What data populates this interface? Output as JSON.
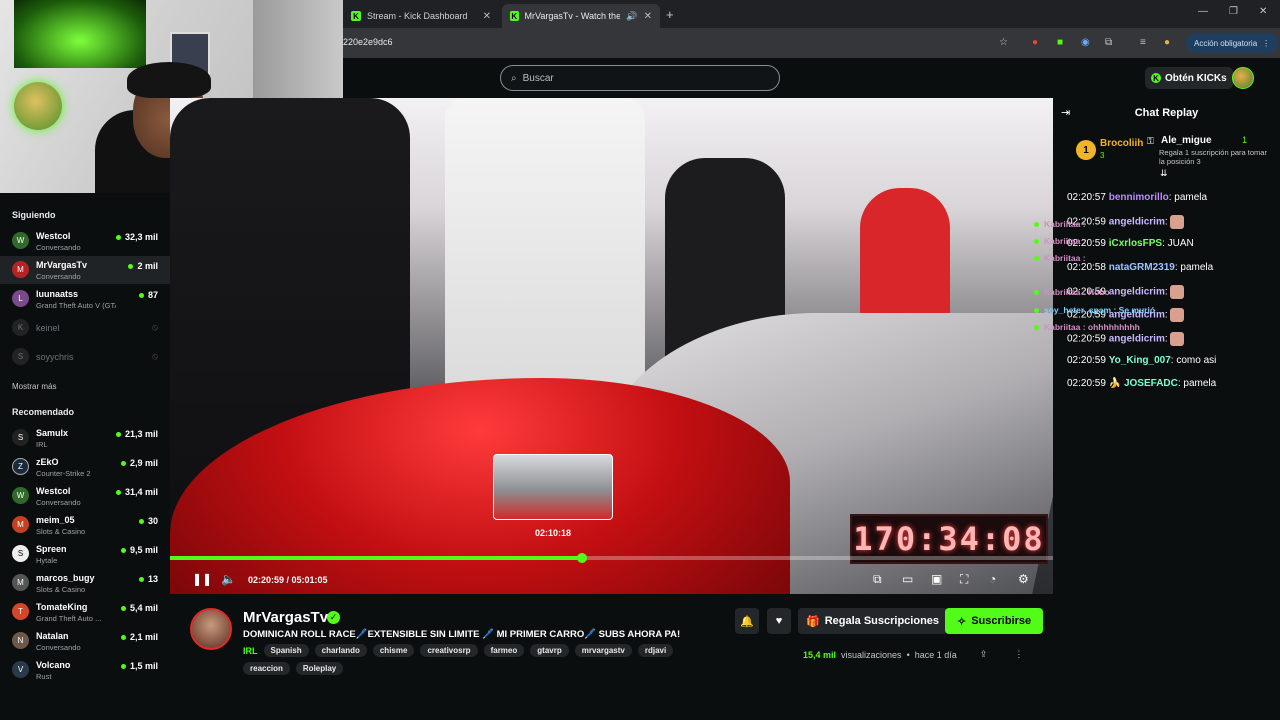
{
  "browser": {
    "tabs": [
      {
        "label": "Stream - Kick Dashboard"
      },
      {
        "label": "MrVargasTv - Watch the VO"
      }
    ],
    "url": "220e2e9dc6",
    "action_label": "Acción obligatoria"
  },
  "header": {
    "search_placeholder": "Buscar",
    "kicks_label": "Obtén KICKs"
  },
  "sidebar": {
    "following_title": "Siguiendo",
    "following": [
      {
        "name": "Westcol",
        "sub": "Conversando",
        "viewers": "32,3 mil",
        "avatar_letter": "W"
      },
      {
        "name": "MrVargasTv",
        "sub": "Conversando",
        "viewers": "2 mil",
        "avatar_letter": "M"
      },
      {
        "name": "luunaatss",
        "sub": "Grand Theft Auto V (GTA)",
        "viewers": "87",
        "avatar_letter": "L"
      },
      {
        "name": "keinel",
        "sub": "",
        "viewers": "",
        "avatar_letter": "K"
      },
      {
        "name": "soyychris",
        "sub": "",
        "viewers": "",
        "avatar_letter": "S"
      }
    ],
    "more_label": "Mostrar más",
    "recommended_title": "Recomendado",
    "recommended": [
      {
        "name": "Samulx",
        "sub": "IRL",
        "viewers": "21,3 mil",
        "avatar_letter": "S"
      },
      {
        "name": "zEkO",
        "sub": "Counter-Strike 2",
        "viewers": "2,9 mil",
        "avatar_letter": "Z"
      },
      {
        "name": "Westcol",
        "sub": "Conversando",
        "viewers": "31,4 mil",
        "avatar_letter": "W"
      },
      {
        "name": "meim_05",
        "sub": "Slots & Casino",
        "viewers": "30",
        "avatar_letter": "M"
      },
      {
        "name": "Spreen",
        "sub": "Hytale",
        "viewers": "9,5 mil",
        "avatar_letter": "S"
      },
      {
        "name": "marcos_bugy",
        "sub": "Slots & Casino",
        "viewers": "13",
        "avatar_letter": "M"
      },
      {
        "name": "TomateKing",
        "sub": "Grand Theft Auto ...",
        "viewers": "5,4 mil",
        "avatar_letter": "T"
      },
      {
        "name": "Natalan",
        "sub": "Conversando",
        "viewers": "2,1 mil",
        "avatar_letter": "N"
      },
      {
        "name": "Volcano",
        "sub": "Rust",
        "viewers": "1,5 mil",
        "avatar_letter": "V"
      }
    ]
  },
  "video": {
    "clock_text": "170:34:08",
    "hover_time": "02:10:18",
    "time_current": "02:20:59",
    "time_total": "05:01:05",
    "time_label": "02:20:59 / 05:01:05",
    "progress_fraction": 0.4668,
    "hover_fraction": 0.433
  },
  "channel": {
    "name": "MrVargasTv",
    "title": "DOMINICAN ROLL RACE🖊️EXTENSIBLE SIN LIMITE 🖊️ MI PRIMER CARRO🖊️ SUBS AHORA PA!",
    "category": "IRL",
    "tags": [
      "Spanish",
      "charlando",
      "chisme",
      "creativosrp",
      "farmeo",
      "gtavrp",
      "mrvargastv",
      "rdjavi",
      "reaccion",
      "Roleplay"
    ],
    "gift_label": "Regala Suscripciones",
    "subscribe_label": "Suscribirse",
    "views_count": "15,4 mil",
    "views_label": "visualizaciones",
    "age_label": "hace 1 día"
  },
  "chat": {
    "title": "Chat Replay",
    "pinned": {
      "rank": "1",
      "top_gifter": "Brocoliih",
      "top_gifter_count": "3",
      "second_user": "Ale_migue",
      "second_count": "1",
      "second_note": "Regala 1 suscripción para tomar la posición 3"
    },
    "messages": [
      {
        "time": "02:20:57",
        "user": "bennimorillo",
        "color": "#b98cff",
        "text": ": pamela"
      },
      {
        "time": "02:20:59",
        "user": "angeldicrim",
        "color": "#c8b5ff",
        "text": ":"
      },
      {
        "time": "02:20:59",
        "user": "iCxrlosFPS",
        "color": "#7dff6a",
        "text": ": JUAN"
      },
      {
        "time": "02:20:58",
        "user": "nataGRM2319",
        "color": "#9fc3ff",
        "text": ": pamela"
      },
      {
        "time": "02:20:59",
        "user": "angeldicrim",
        "color": "#c8b5ff",
        "text": ":"
      },
      {
        "time": "02:20:59",
        "user": "angeldicrim",
        "color": "#c8b5ff",
        "text": ":"
      },
      {
        "time": "02:20:59",
        "user": "angeldicrim",
        "color": "#c8b5ff",
        "text": ":"
      },
      {
        "time": "02:20:59",
        "user": "Yo_King_007",
        "color": "#7dffd0",
        "text": ": como asi"
      },
      {
        "time": "02:20:59",
        "user": "JOSEFADC",
        "color": "#7dffd0",
        "text": ": pamela"
      }
    ],
    "overlay_lines": [
      {
        "text": "Kabriitaa :"
      },
      {
        "text": "Kabriitaa :"
      },
      {
        "text": "Kabriitaa :"
      },
      {
        "text": "Kabriitaa : Hobo"
      },
      {
        "text": "soy_heter_spam : Se murió"
      },
      {
        "text": "Kabriitaa : ohhhhhhhhh"
      }
    ]
  },
  "colors": {
    "accent": "#53fc18",
    "background": "#0b0e0f"
  }
}
